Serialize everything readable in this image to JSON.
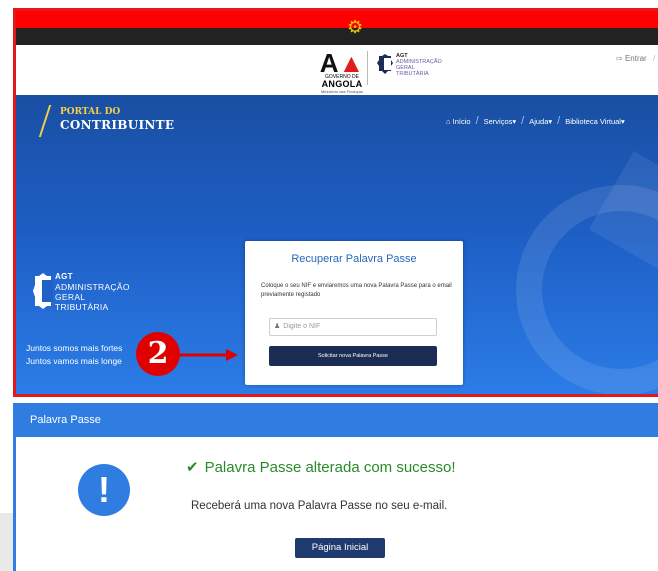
{
  "header": {
    "entrar_label": "Entrar",
    "entrar_sep": "/",
    "gov_logo": {
      "line1": "GOVERNO DE",
      "line2": "ANGOLA",
      "line3": "Ministério das Finanças"
    },
    "agt_small": {
      "abbr": "AGT",
      "l1": "ADMINISTRAÇÃO",
      "l2": "GERAL",
      "l3": "TRIBUTÁRIA"
    }
  },
  "portal": {
    "line1": "PORTAL DO",
    "line2": "CONTRIBUINTE"
  },
  "nav": {
    "items": [
      {
        "label": "Início",
        "icon": "home-icon"
      },
      {
        "label": "Serviços▾"
      },
      {
        "label": "Ajuda▾"
      },
      {
        "label": "Biblioteca Virtual▾"
      }
    ],
    "sep": "/"
  },
  "agt_big": {
    "abbr": "AGT",
    "l1": "ADMINISTRAÇÃO",
    "l2": "GERAL",
    "l3": "TRIBUTÁRIA"
  },
  "slogan": {
    "line1": "Juntos somos mais fortes",
    "line2": "Juntos vamos mais longe"
  },
  "recover_modal": {
    "title": "Recuperar Palavra Passe",
    "description": "Coloque o seu NIF e enviaremos uma nova Palavra Passe para o email previamente registado",
    "nif_placeholder": "Digite o NIF",
    "submit_label": "Solicitar nova Palavra Passe"
  },
  "step_marker": "2",
  "result_panel": {
    "header": "Palavra Passe",
    "success": "Palavra Passe alterada com sucesso!",
    "info": "Receberá uma nova Palavra Passe no seu e-mail.",
    "home_button": "Página Inicial",
    "info_icon_glyph": "!"
  },
  "colors": {
    "highlight_border": "#e3191c",
    "hero_blue": "#1d5ec4",
    "panel_blue": "#2f7de1",
    "button_navy": "#1c2d55",
    "success_green": "#2a8a2a",
    "portal_gold": "#f7d048"
  }
}
